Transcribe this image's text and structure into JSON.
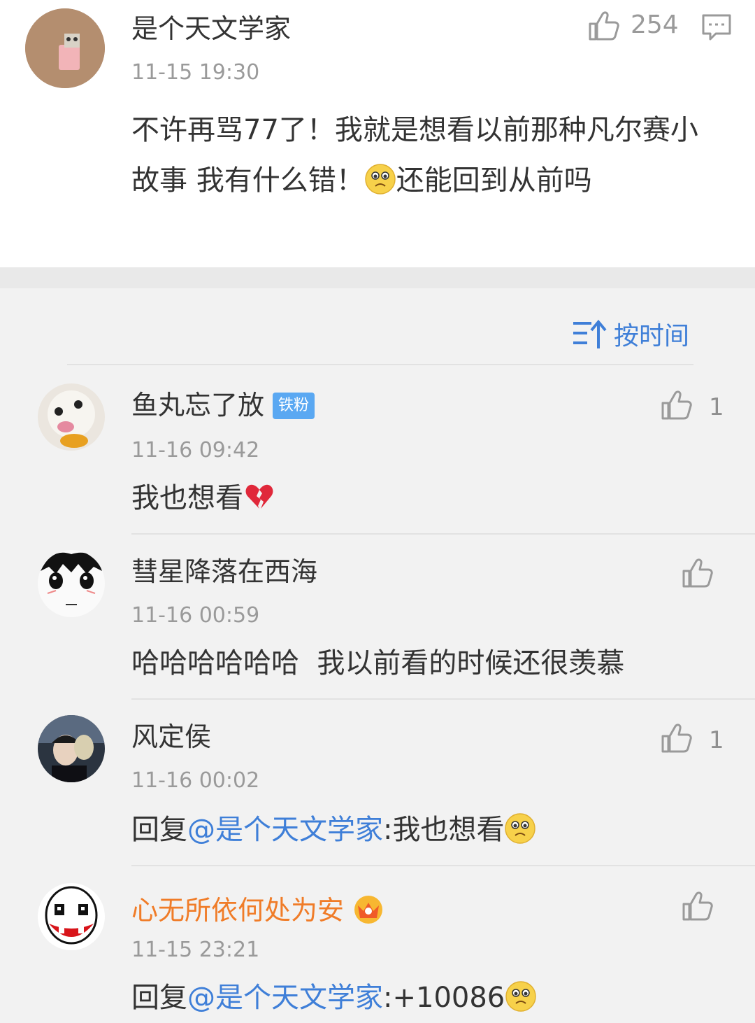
{
  "post": {
    "author": "是个天文学家",
    "time": "11-15 19:30",
    "likes": "254",
    "text_before_emoji": "不许再骂77了！我就是想看以前那种凡尔赛小故事 我有什么错！",
    "text_after_emoji": "还能回到从前吗"
  },
  "sort": {
    "label": "按时间"
  },
  "comments": [
    {
      "author": "鱼丸忘了放",
      "badge": "铁粉",
      "time": "11-16 09:42",
      "text": "我也想看",
      "likes": "1"
    },
    {
      "author": "彗星降落在西海",
      "time": "11-16 00:59",
      "text": "哈哈哈哈哈哈  我以前看的时候还很羡慕",
      "likes": ""
    },
    {
      "author": "风定侯",
      "time": "11-16 00:02",
      "reply_prefix": "回复",
      "mention": "@是个天文学家",
      "text": ":我也想看",
      "likes": "1"
    },
    {
      "author": "心无所依何处为安",
      "time": "11-15 23:21",
      "reply_prefix": "回复",
      "mention": "@是个天文学家",
      "text": ":+10086",
      "likes": ""
    }
  ],
  "colors": {
    "link": "#3f7fd8",
    "vip_name": "#f07c28",
    "badge": "#5aa8f2"
  }
}
